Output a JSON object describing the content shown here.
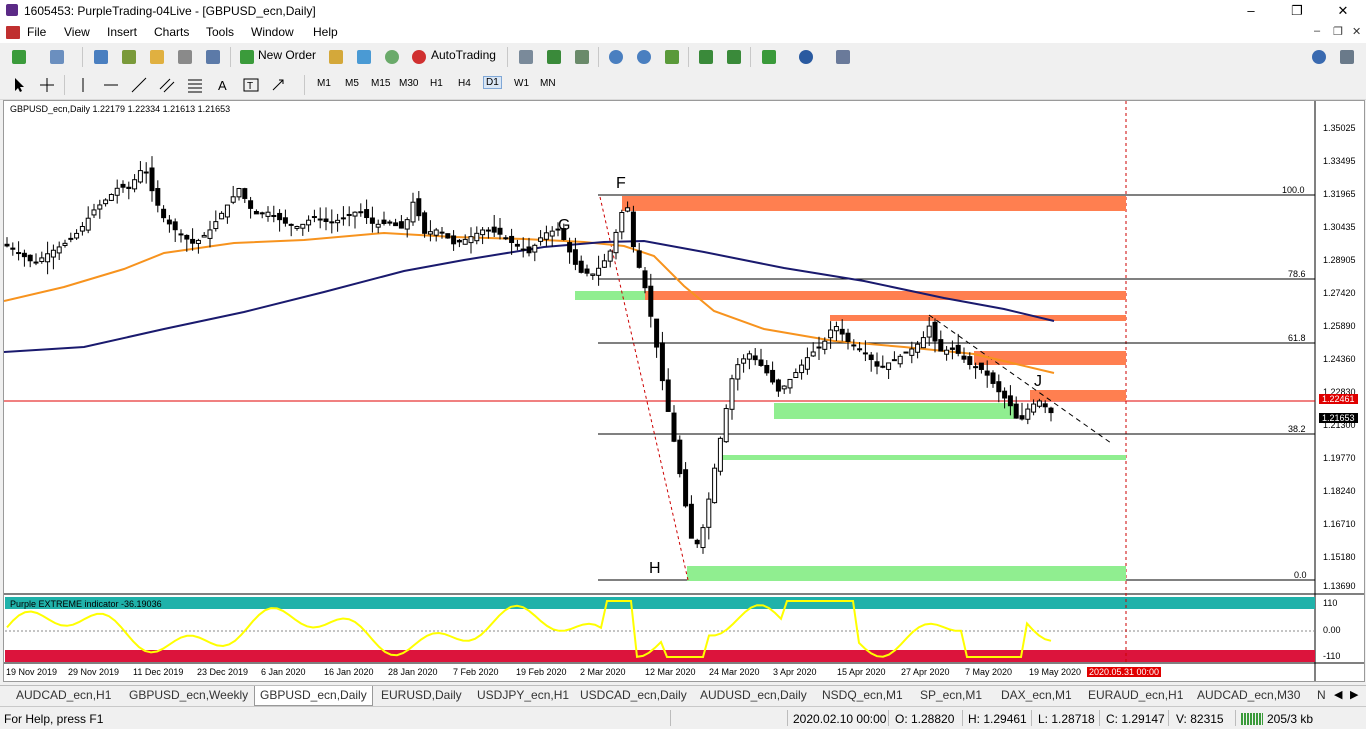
{
  "window": {
    "title": "1605453: PurpleTrading-04Live - [GBPUSD_ecn,Daily]"
  },
  "menu": [
    "File",
    "View",
    "Insert",
    "Charts",
    "Tools",
    "Window",
    "Help"
  ],
  "toolbar": {
    "new_order": "New Order",
    "autotrading": "AutoTrading"
  },
  "timeframes": [
    "M1",
    "M5",
    "M15",
    "M30",
    "H1",
    "H4",
    "D1",
    "W1",
    "MN"
  ],
  "active_timeframe": "D1",
  "chart": {
    "header": "GBPUSD_ecn,Daily  1.22179 1.22334 1.21613 1.21653",
    "price_axis": [
      "1.35025",
      "1.33495",
      "1.31965",
      "1.30435",
      "1.28905",
      "1.27420",
      "1.25890",
      "1.24360",
      "1.22830",
      "1.21300",
      "1.19770",
      "1.18240",
      "1.16710",
      "1.15180",
      "1.13690"
    ],
    "current_price": "1.21653",
    "red_line_price": "1.22461",
    "fib_levels": [
      "100.0",
      "78.6",
      "61.8",
      "38.2",
      "0.0"
    ],
    "point_labels": [
      "F",
      "G",
      "H",
      "J"
    ],
    "dates": [
      "19 Nov 2019",
      "29 Nov 2019",
      "11 Dec 2019",
      "23 Dec 2019",
      "6 Jan 2020",
      "16 Jan 2020",
      "28 Jan 2020",
      "7 Feb 2020",
      "19 Feb 2020",
      "2 Mar 2020",
      "12 Mar 2020",
      "24 Mar 2020",
      "3 Apr 2020",
      "15 Apr 2020",
      "27 Apr 2020",
      "7 May 2020",
      "19 May 2020"
    ],
    "date_marker": "2020.05.31 00:00",
    "indicator": {
      "label": "Purple EXTREME indicator -36.19036",
      "levels": [
        "110",
        "0.00",
        "-110"
      ]
    },
    "colors": {
      "bull_candle": "#ffffff",
      "bear_candle": "#000000",
      "ma_fast": "#f7931e",
      "ma_slow": "#1a1a6e",
      "resistance": "#ff7f50",
      "support": "#90ee90",
      "indicator_line": "#ffff00",
      "teal_band": "#20b2aa",
      "red_band": "#dc143c"
    }
  },
  "tabs": [
    "AUDCAD_ecn,H1",
    "GBPUSD_ecn,Weekly",
    "GBPUSD_ecn,Daily",
    "EURUSD,Daily",
    "USDJPY_ecn,H1",
    "USDCAD_ecn,Daily",
    "AUDUSD_ecn,Daily",
    "NSDQ_ecn,M1",
    "SP_ecn,M1",
    "DAX_ecn,M1",
    "EURAUD_ecn,H1",
    "AUDCAD_ecn,M30",
    "N"
  ],
  "active_tab": "GBPUSD_ecn,Daily",
  "status": {
    "help": "For Help, press F1",
    "datetime": "2020.02.10 00:00",
    "open": "O: 1.28820",
    "high": "H: 1.29461",
    "low": "L: 1.28718",
    "close": "C: 1.29147",
    "volume": "V: 82315",
    "traffic": "205/3 kb"
  }
}
